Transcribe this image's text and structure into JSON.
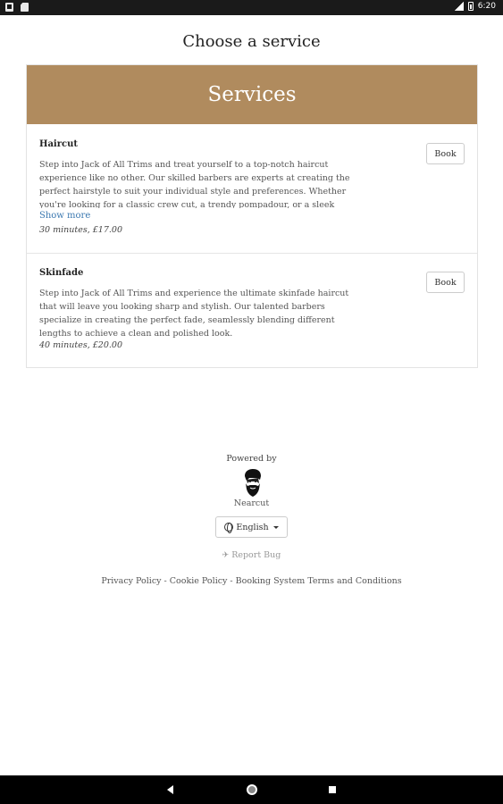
{
  "status_bar": {
    "time": "6:20",
    "icons": [
      "notification-icon",
      "document-icon",
      "signal-icon",
      "battery-icon"
    ]
  },
  "page": {
    "title": "Choose a service"
  },
  "services": {
    "header": "Services",
    "items": [
      {
        "name": "Haircut",
        "description": "Step into Jack of All Trims and treat yourself to a top-notch haircut experience like no other. Our skilled barbers are experts at creating the perfect hairstyle to suit your individual style and preferences. Whether you're looking for a classic crew cut, a trendy pompadour, or a sleek side",
        "show_more": "Show more",
        "meta": "30 minutes, £17.00",
        "book_label": "Book"
      },
      {
        "name": "Skinfade",
        "description": "Step into Jack of All Trims and experience the ultimate skinfade haircut that will leave you looking sharp and stylish. Our talented barbers specialize in creating the perfect fade, seamlessly blending different lengths to achieve a clean and polished look.",
        "meta": "40 minutes, £20.00",
        "book_label": "Book"
      }
    ]
  },
  "footer": {
    "powered_by": "Powered by",
    "brand": "Nearcut",
    "language": "English",
    "report_bug": "Report Bug",
    "legal": "Privacy Policy - Cookie Policy - Booking System Terms and Conditions"
  },
  "colors": {
    "header_bg": "#b08b5e",
    "link": "#3b78b0"
  }
}
